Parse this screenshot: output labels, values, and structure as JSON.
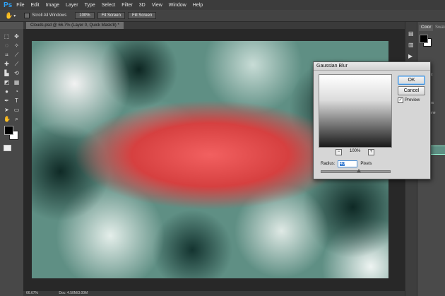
{
  "app": {
    "logo": "Ps"
  },
  "menu": [
    "File",
    "Edit",
    "Image",
    "Layer",
    "Type",
    "Select",
    "Filter",
    "3D",
    "View",
    "Window",
    "Help"
  ],
  "options": {
    "scroll_all": "Scroll All Windows",
    "zoom_100": "100%",
    "fit_screen": "Fit Screen",
    "fill_screen": "Fill Screen"
  },
  "document": {
    "tab": "Clouds.psd @ 66.7% (Layer 0, Quick Mask/8) *"
  },
  "status": {
    "zoom": "66.67%",
    "doc": "Doc: 4.50M/3.00M"
  },
  "panel": {
    "color_tab": "Color",
    "swatches_tab": "Swatche",
    "adjust": "adjust",
    "layers": "Layers",
    "chann": "Channe"
  },
  "dialog": {
    "title": "Gaussian Blur",
    "ok": "OK",
    "cancel": "Cancel",
    "preview_label": "Preview",
    "zoom_value": "100%",
    "zoom_out": "−",
    "zoom_in": "+",
    "radius_label": "Radius:",
    "radius_value": "40",
    "unit": "Pixels",
    "slider_fraction": 0.55,
    "preview_checked": true
  },
  "colors": {
    "accent": "#2fa3f6",
    "quick_mask": "#d64040"
  }
}
